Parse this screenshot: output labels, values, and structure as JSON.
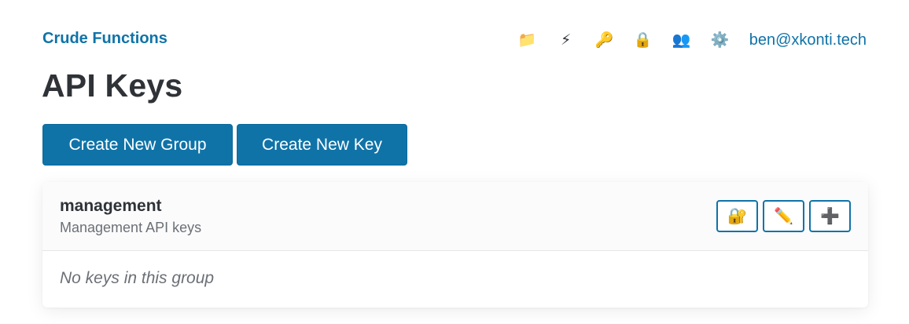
{
  "brand": {
    "title": "Crude Functions"
  },
  "nav": {
    "icons": [
      {
        "name": "folder-icon",
        "glyph": "📁"
      },
      {
        "name": "lightning-icon",
        "glyph": "⚡"
      },
      {
        "name": "key-icon",
        "glyph": "🔑"
      },
      {
        "name": "lock-icon",
        "glyph": "🔒"
      },
      {
        "name": "users-icon",
        "glyph": "👥"
      },
      {
        "name": "gear-icon",
        "glyph": "⚙️"
      }
    ],
    "user": "ben@xkonti.tech"
  },
  "page": {
    "title": "API Keys"
  },
  "actions": {
    "create_group": "Create New Group",
    "create_key": "Create New Key"
  },
  "groups": [
    {
      "name": "management",
      "description": "Management API keys",
      "buttons": [
        {
          "name": "lock-with-key-icon",
          "glyph": "🔐"
        },
        {
          "name": "pencil-icon",
          "glyph": "✏️"
        },
        {
          "name": "plus-icon",
          "glyph": "➕"
        }
      ],
      "empty_message": "No keys in this group"
    }
  ],
  "colors": {
    "accent": "#0f73a8",
    "text": "#2f3237",
    "muted": "#6b7076"
  }
}
